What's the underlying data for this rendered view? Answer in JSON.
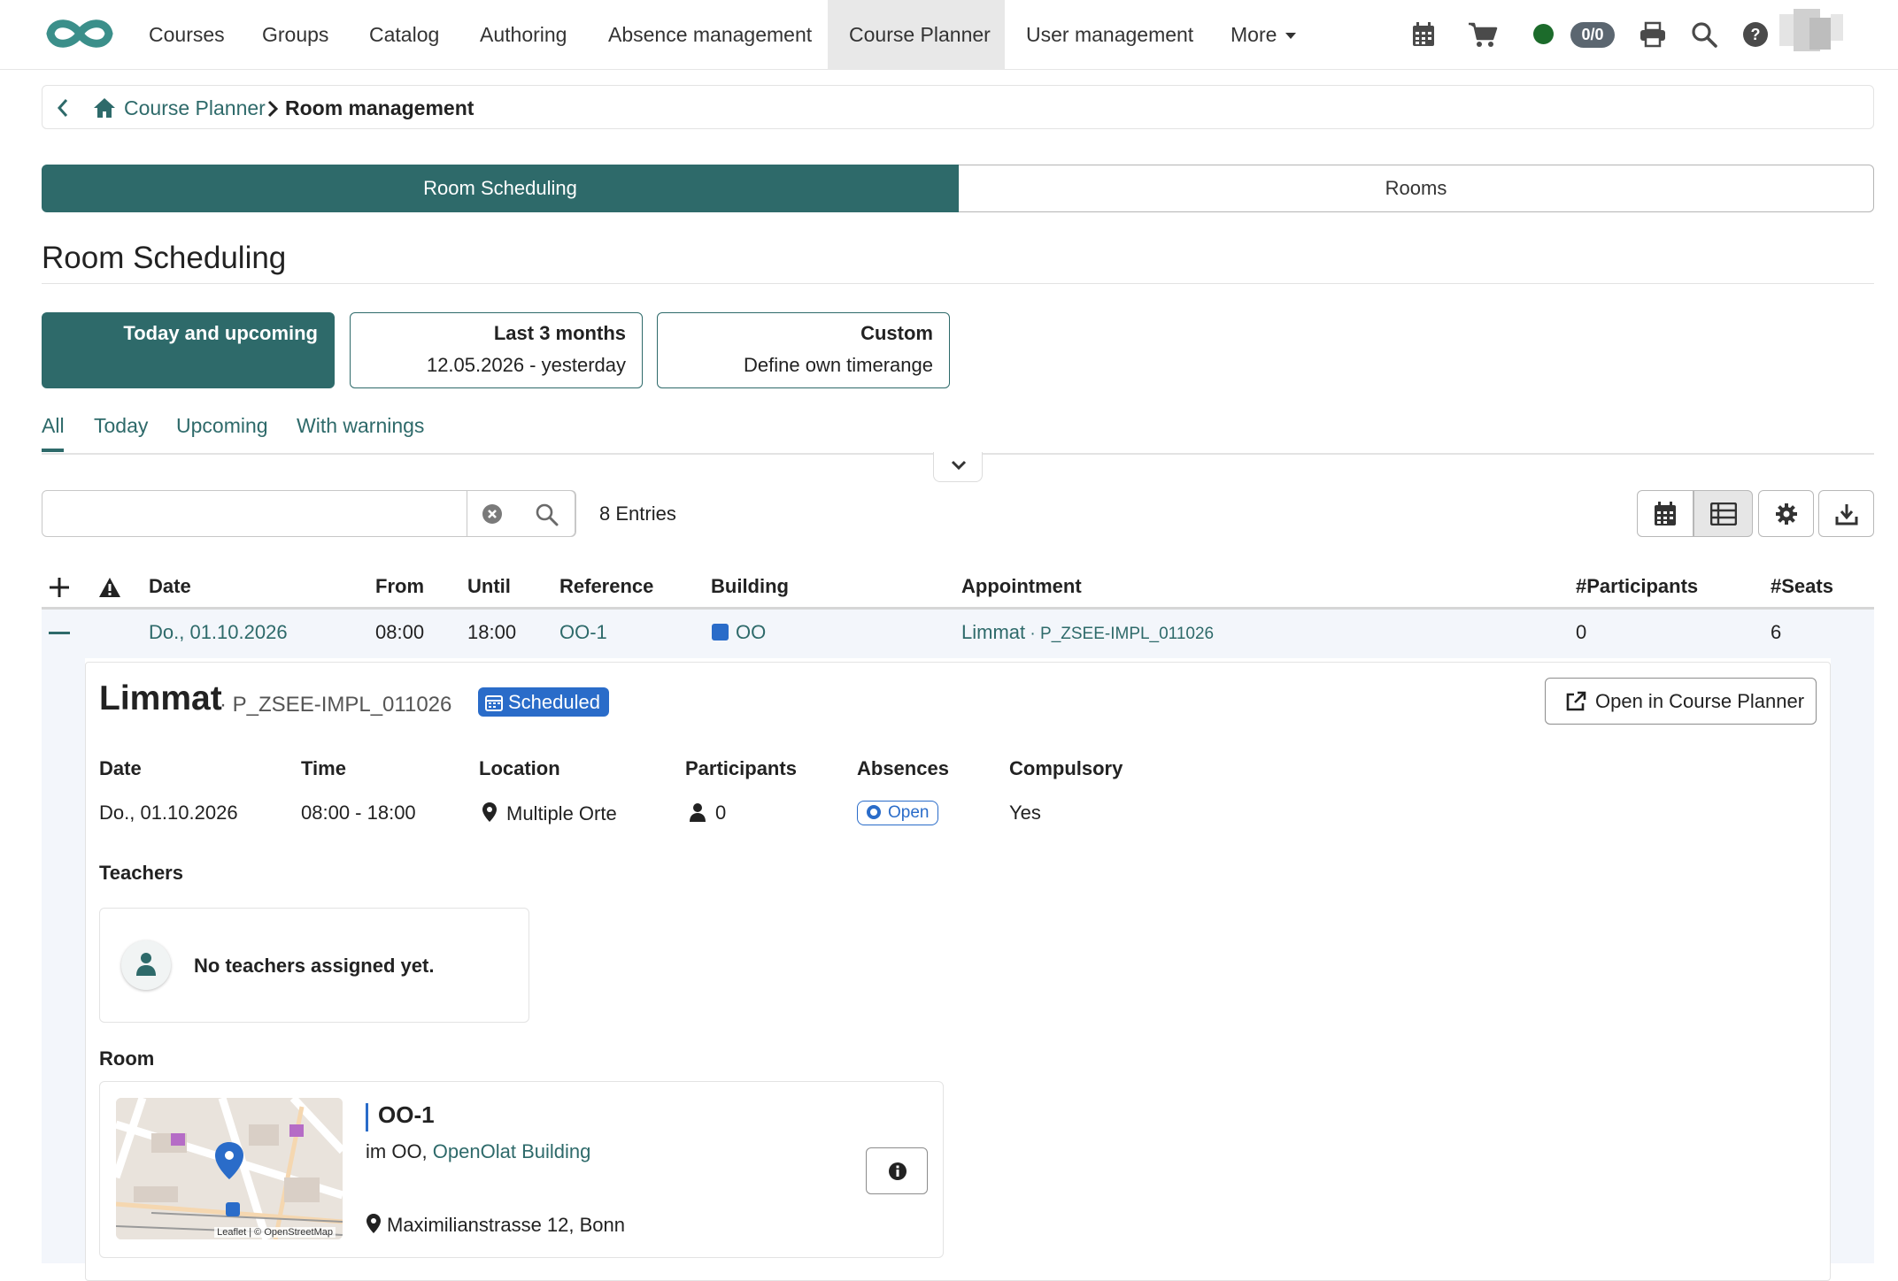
{
  "nav": {
    "items": [
      "Courses",
      "Groups",
      "Catalog",
      "Authoring",
      "Absence management",
      "Course Planner",
      "User management",
      "More"
    ],
    "active": "Course Planner",
    "badge": "0/0",
    "icons": [
      "calendar-icon",
      "cart-icon",
      "status-dot",
      "badge",
      "print-icon",
      "search-icon",
      "help-icon",
      "avatar"
    ]
  },
  "breadcrumb": {
    "parent": "Course Planner",
    "current": "Room management"
  },
  "segments": {
    "scheduling": "Room Scheduling",
    "rooms": "Rooms"
  },
  "page": {
    "title": "Room Scheduling"
  },
  "periods": [
    {
      "title": "Today and upcoming",
      "subtitle": ""
    },
    {
      "title": "Last 3 months",
      "subtitle": "12.05.2026 - yesterday"
    },
    {
      "title": "Custom",
      "subtitle": "Define own timerange"
    }
  ],
  "tabs": [
    "All",
    "Today",
    "Upcoming",
    "With warnings"
  ],
  "search": {
    "value": "",
    "placeholder": ""
  },
  "entries": "8 Entries",
  "table": {
    "headers": [
      "Date",
      "From",
      "Until",
      "Reference",
      "Building",
      "Appointment",
      "#Participants",
      "#Seats"
    ],
    "row": {
      "date": "Do., 01.10.2026",
      "from": "08:00",
      "until": "18:00",
      "reference": "OO-1",
      "building": "OO",
      "building_color": "#2a6cc9",
      "appointment": "Limmat",
      "appointment_sep": " · ",
      "appointment_code": "P_ZSEE-IMPL_011026",
      "participants": "0",
      "seats": "6"
    }
  },
  "detail": {
    "title": "Limmat",
    "subtitle": "· P_ZSEE-IMPL_011026",
    "status": "Scheduled",
    "open_button": "Open in Course Planner",
    "labels": {
      "date": "Date",
      "time": "Time",
      "location": "Location",
      "participants": "Participants",
      "absences": "Absences",
      "compulsory": "Compulsory"
    },
    "values": {
      "date": "Do., 01.10.2026",
      "time": "08:00 - 18:00",
      "location": "Multiple Orte",
      "participants": "0",
      "absences": "Open",
      "compulsory": "Yes"
    },
    "teachers_heading": "Teachers",
    "no_teachers": "No teachers assigned yet.",
    "room_heading": "Room",
    "room": {
      "name": "OO-1",
      "loc_prefix": "im OO,",
      "building_link": "OpenOlat Building",
      "address": "Maximilianstrasse 12, Bonn",
      "map_attribution": "Leaflet | © OpenStreetMap"
    }
  },
  "colors": {
    "accent": "#2e6a6a",
    "blue": "#2a6cc9"
  }
}
